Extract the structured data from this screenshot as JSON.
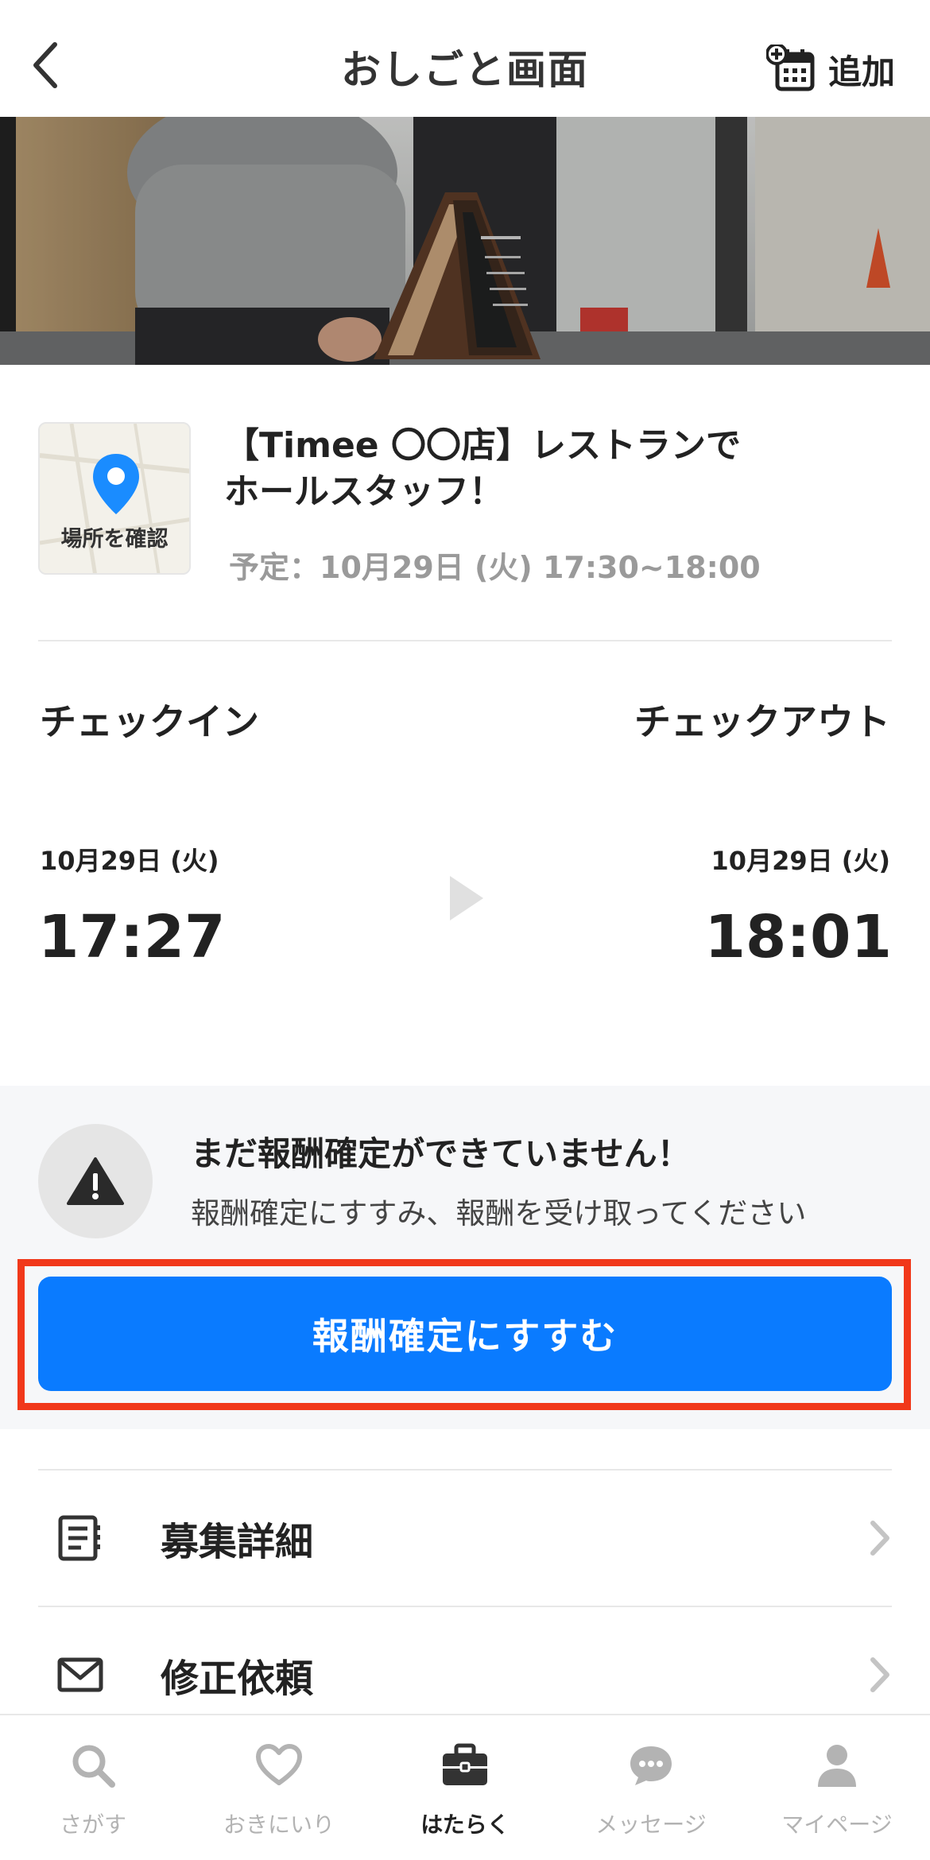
{
  "header": {
    "title": "おしごと画面",
    "add_label": "追加"
  },
  "job": {
    "map_label": "場所を確認",
    "title": "【Timee 〇〇店】レストランで ホールスタッフ！",
    "schedule": "予定：10月29日 (火) 17:30~18:00"
  },
  "checkin": {
    "label": "チェックイン",
    "date": "10月29日 (火)",
    "time": "17:27"
  },
  "checkout": {
    "label": "チェックアウト",
    "date": "10月29日 (火)",
    "time": "18:01"
  },
  "warning": {
    "title": "まだ報酬確定ができていません！",
    "subtitle": "報酬確定にすすみ、報酬を受け取ってください",
    "button_label": "報酬確定にすすむ"
  },
  "menu": [
    {
      "label": "募集詳細",
      "icon": "document-icon"
    },
    {
      "label": "修正依頼",
      "icon": "envelope-icon"
    }
  ],
  "nav": {
    "items": [
      {
        "label": "さがす",
        "icon": "search-icon"
      },
      {
        "label": "おきにいり",
        "icon": "heart-icon"
      },
      {
        "label": "はたらく",
        "icon": "briefcase-icon"
      },
      {
        "label": "メッセージ",
        "icon": "chat-icon"
      },
      {
        "label": "マイページ",
        "icon": "person-icon"
      }
    ],
    "active": "はたらく"
  },
  "colors": {
    "primary": "#0A7BFF",
    "highlight": "#F1381A",
    "map_pin": "#1A8CFF"
  }
}
